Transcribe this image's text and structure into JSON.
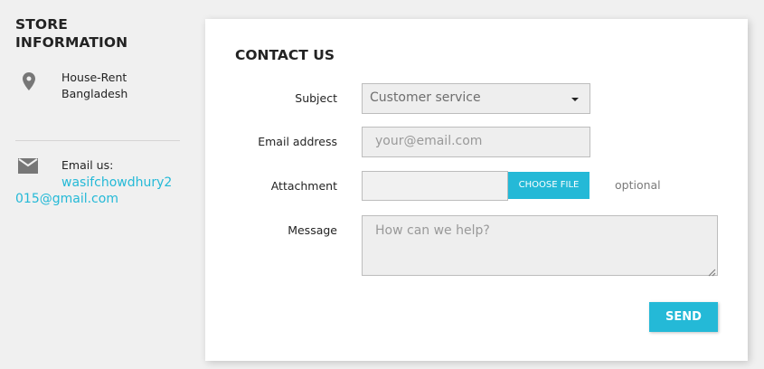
{
  "store_info": {
    "title": "STORE INFORMATION",
    "address_icon": "location-pin-icon",
    "address_line1": "House-Rent",
    "address_line2": "Bangladesh",
    "email_icon": "envelope-icon",
    "email_label": "Email us:",
    "email_value": "wasifchowdhury2015@gmail.com"
  },
  "contact": {
    "title": "CONTACT US",
    "subject_label": "Subject",
    "subject_value": "Customer service",
    "email_label": "Email address",
    "email_placeholder": "your@email.com",
    "attachment_label": "Attachment",
    "choose_file_label": "CHOOSE FILE",
    "optional_text": "optional",
    "message_label": "Message",
    "message_placeholder": "How can we help?",
    "send_label": "SEND"
  },
  "colors": {
    "accent": "#24b9d7",
    "page_bg": "#f0f0f0",
    "field_bg": "#eeeeee"
  }
}
